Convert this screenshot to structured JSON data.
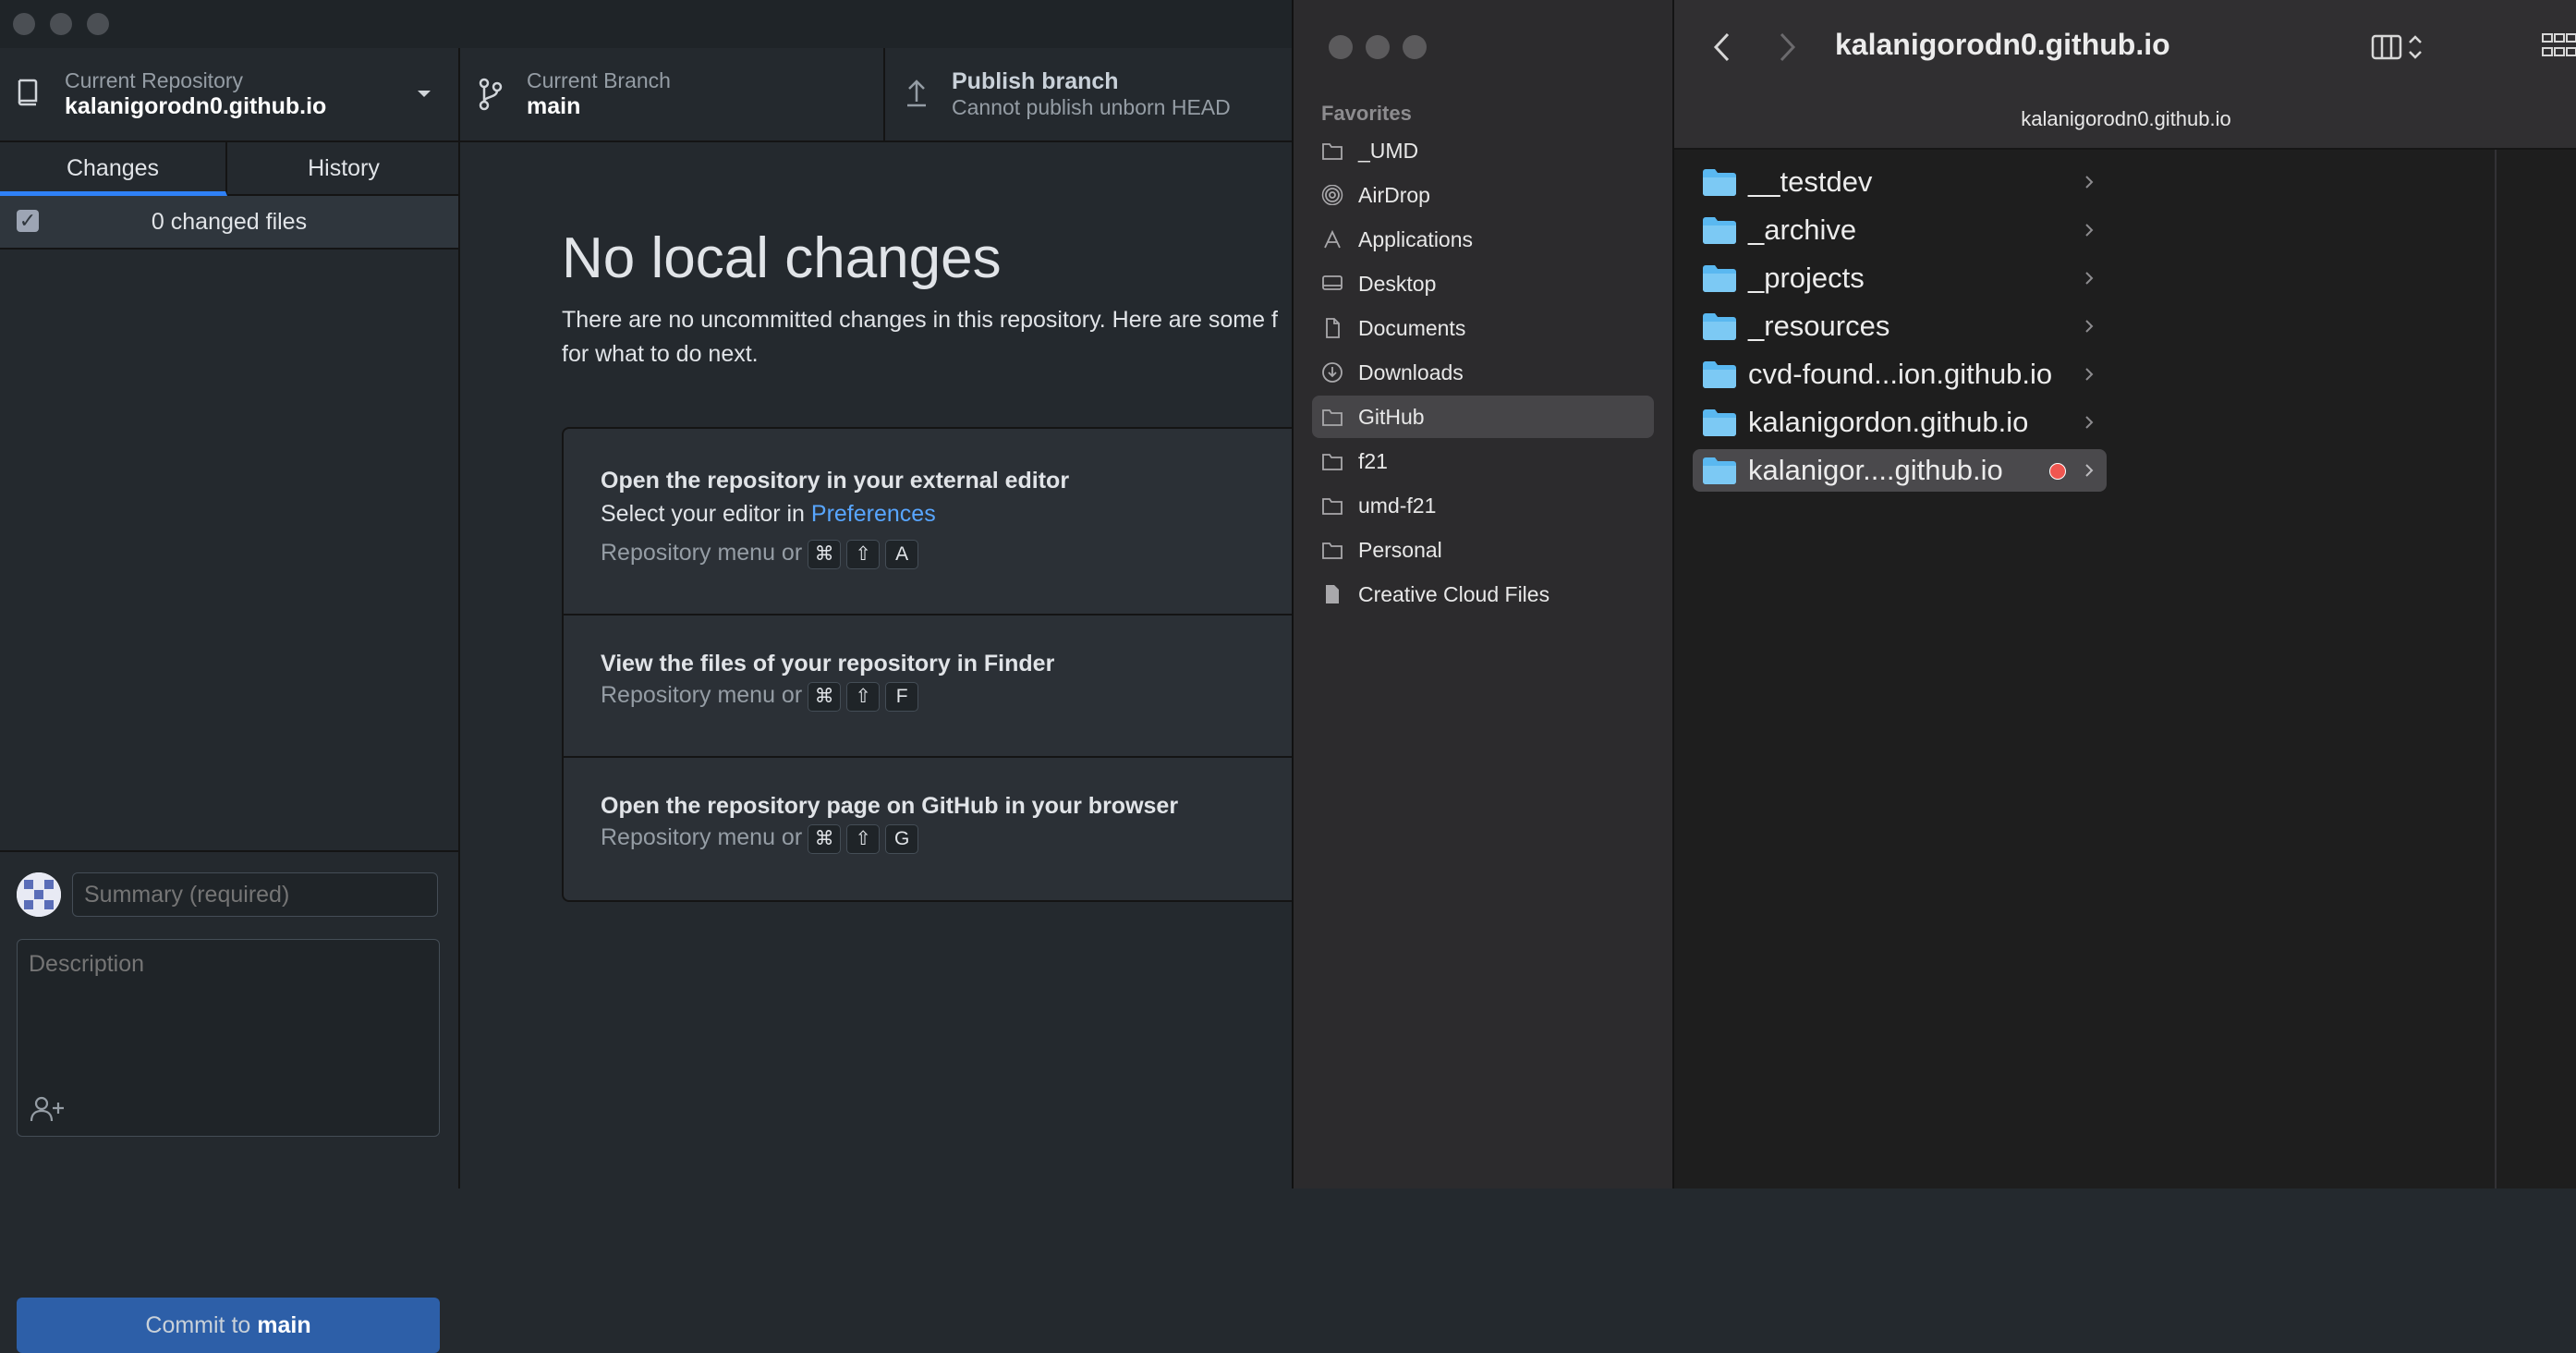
{
  "github_desktop": {
    "toolbar": {
      "repository": {
        "label": "Current Repository",
        "value": "kalanigorodn0.github.io"
      },
      "branch": {
        "label": "Current Branch",
        "value": "main"
      },
      "publish": {
        "label": "Publish branch",
        "value": "Cannot publish unborn HEAD"
      }
    },
    "tabs": {
      "changes": "Changes",
      "history": "History"
    },
    "changes": {
      "count_text": "0 changed files"
    },
    "commit": {
      "summary_placeholder": "Summary (required)",
      "description_placeholder": "Description",
      "button_prefix": "Commit to",
      "button_branch": "main"
    },
    "blank_slate": {
      "title": "No local changes",
      "description_line1": "There are no uncommitted changes in this repository. Here are some f",
      "description_line2": "for what to do next.",
      "cards": [
        {
          "title": "Open the repository in your external editor",
          "sub_prefix": "Select your editor in",
          "sub_link": "Preferences",
          "shortcut_text": "Repository menu or",
          "keys": [
            "⌘",
            "⇧",
            "A"
          ]
        },
        {
          "title": "View the files of your repository in Finder",
          "shortcut_text": "Repository menu or",
          "keys": [
            "⌘",
            "⇧",
            "F"
          ]
        },
        {
          "title": "Open the repository page on GitHub in your browser",
          "shortcut_text": "Repository menu or",
          "keys": [
            "⌘",
            "⇧",
            "G"
          ]
        }
      ]
    }
  },
  "finder": {
    "title": "kalanigorodn0.github.io",
    "path_title": "kalanigorodn0.github.io",
    "favorites_title": "Favorites",
    "favorites": [
      {
        "label": "_UMD",
        "icon": "folder-icon"
      },
      {
        "label": "AirDrop",
        "icon": "airdrop-icon"
      },
      {
        "label": "Applications",
        "icon": "applications-icon"
      },
      {
        "label": "Desktop",
        "icon": "desktop-icon"
      },
      {
        "label": "Documents",
        "icon": "document-icon"
      },
      {
        "label": "Downloads",
        "icon": "download-icon"
      },
      {
        "label": "GitHub",
        "icon": "folder-icon",
        "selected": true
      },
      {
        "label": "f21",
        "icon": "folder-icon"
      },
      {
        "label": "umd-f21",
        "icon": "folder-icon"
      },
      {
        "label": "Personal",
        "icon": "folder-icon"
      },
      {
        "label": "Creative Cloud Files",
        "icon": "file-icon"
      }
    ],
    "folders": [
      {
        "name": "__testdev"
      },
      {
        "name": "_archive"
      },
      {
        "name": "_projects"
      },
      {
        "name": "_resources"
      },
      {
        "name": "cvd-found...ion.github.io"
      },
      {
        "name": "kalanigordon.github.io"
      },
      {
        "name": "kalanigor....github.io",
        "selected": true,
        "tag": "red"
      }
    ],
    "colors": {
      "folder": "#5ab8f0",
      "tag_red": "#f05650",
      "selection": "#4a494c"
    }
  }
}
